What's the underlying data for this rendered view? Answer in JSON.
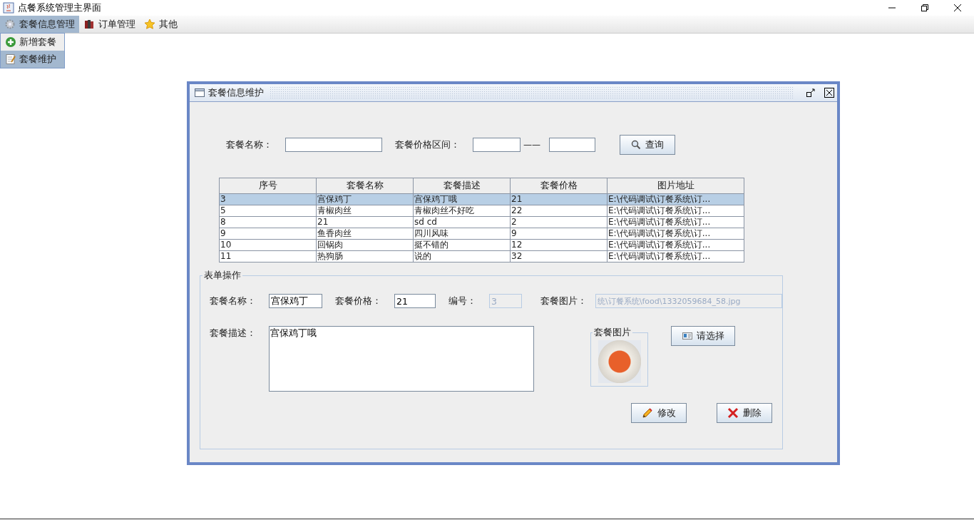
{
  "window": {
    "title": "点餐系统管理主界面"
  },
  "menu_bar": {
    "menus": [
      {
        "label": "套餐信息管理",
        "selected": true
      },
      {
        "label": "订单管理",
        "selected": false
      },
      {
        "label": "其他",
        "selected": false
      }
    ]
  },
  "dropdown": {
    "items": [
      {
        "label": "新增套餐",
        "selected": false
      },
      {
        "label": "套餐维护",
        "selected": true
      }
    ]
  },
  "internal_frame": {
    "title": "套餐信息维护"
  },
  "search": {
    "name_label": "套餐名称：",
    "price_label": "套餐价格区间：",
    "range_separator": "——",
    "button": "查询"
  },
  "table": {
    "columns": [
      "序号",
      "套餐名称",
      "套餐描述",
      "套餐价格",
      "图片地址"
    ],
    "rows": [
      {
        "selected": true,
        "cells": [
          "3",
          "宫保鸡丁",
          "宫保鸡丁哦",
          "21",
          "E:\\代码调试\\订餐系统\\订..."
        ]
      },
      {
        "selected": false,
        "cells": [
          "5",
          "青椒肉丝",
          "青椒肉丝不好吃",
          "22",
          "E:\\代码调试\\订餐系统\\订..."
        ]
      },
      {
        "selected": false,
        "cells": [
          "8",
          "21",
          "sd cd",
          "2",
          "E:\\代码调试\\订餐系统\\订..."
        ]
      },
      {
        "selected": false,
        "cells": [
          "9",
          "鱼香肉丝",
          "四川风味",
          "9",
          "E:\\代码调试\\订餐系统\\订..."
        ]
      },
      {
        "selected": false,
        "cells": [
          "10",
          "回锅肉",
          "挺不错的",
          "12",
          "E:\\代码调试\\订餐系统\\订..."
        ]
      },
      {
        "selected": false,
        "cells": [
          "11",
          "热狗肠",
          "说的",
          "32",
          "E:\\代码调试\\订餐系统\\订..."
        ]
      }
    ]
  },
  "form": {
    "legend": "表单操作",
    "fields": [
      {
        "label": "套餐名称：",
        "value": "宫保鸡丁",
        "disabled": false
      },
      {
        "label": "套餐价格：",
        "value": "21",
        "disabled": false
      },
      {
        "label": "编号：",
        "value": "3",
        "disabled": true
      },
      {
        "label": "套餐图片：",
        "value": "统\\订餐系统\\food\\1332059684_58.jpg",
        "disabled": true
      }
    ],
    "description_label": "套餐描述：",
    "description": "宫保鸡丁哦",
    "image_group": "套餐图片",
    "choose_button": "请选择",
    "edit_button": "修改",
    "delete_button": "删除"
  }
}
